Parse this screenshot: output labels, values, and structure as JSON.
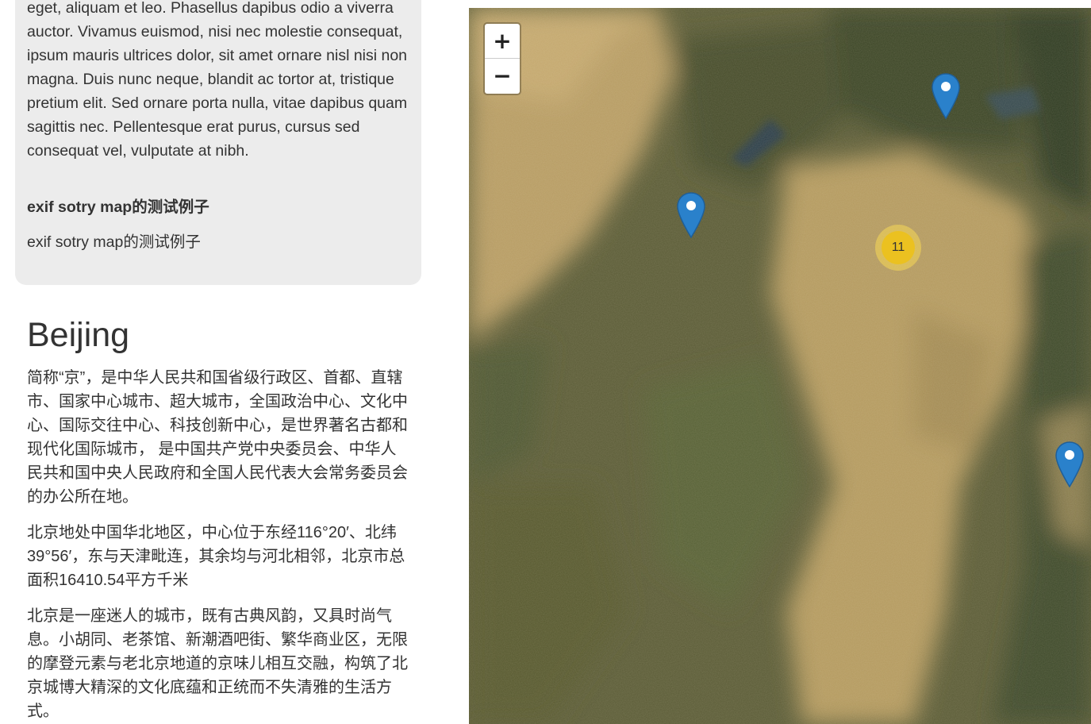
{
  "story": {
    "text": "eget, aliquam et leo. Phasellus dapibus odio a viverra auctor. Vivamus euismod, nisi nec molestie consequat, ipsum mauris ultrices dolor, sit amet ornare nisl nisi non magna. Duis nunc neque, blandit ac tortor at, tristique pretium elit. Sed ornare porta nulla, vitae dapibus quam sagittis nec. Pellentesque erat purus, cursus sed consequat vel, vulputate at nibh.",
    "heading": "exif sotry map的测试例子",
    "subtext": "exif sotry map的测试例子"
  },
  "city": {
    "title": "Beijing",
    "paragraphs": [
      "简称“京”，是中华人民共和国省级行政区、首都、直辖市、国家中心城市、超大城市，全国政治中心、文化中心、国际交往中心、科技创新中心，是世界著名古都和现代化国际城市， 是中国共产党中央委员会、中华人民共和国中央人民政府和全国人民代表大会常务委员会的办公所在地。",
      "北京地处中国华北地区，中心位于东经116°20′、北纬39°56′，东与天津毗连，其余均与河北相邻，北京市总面积16410.54平方千米",
      "北京是一座迷人的城市，既有古典风韵，又具时尚气息。小胡同、老茶馆、新潮酒吧街、繁华商业区，无限的摩登元素与老北京地道的京味儿相互交融，构筑了北京城博大精深的文化底蕴和正统而不失清雅的生活方式。"
    ]
  },
  "map": {
    "zoom_in_label": "+",
    "zoom_out_label": "−",
    "cluster_count": "11",
    "marker_color": "#2a81cb",
    "cluster_color": "#f0c20c"
  }
}
